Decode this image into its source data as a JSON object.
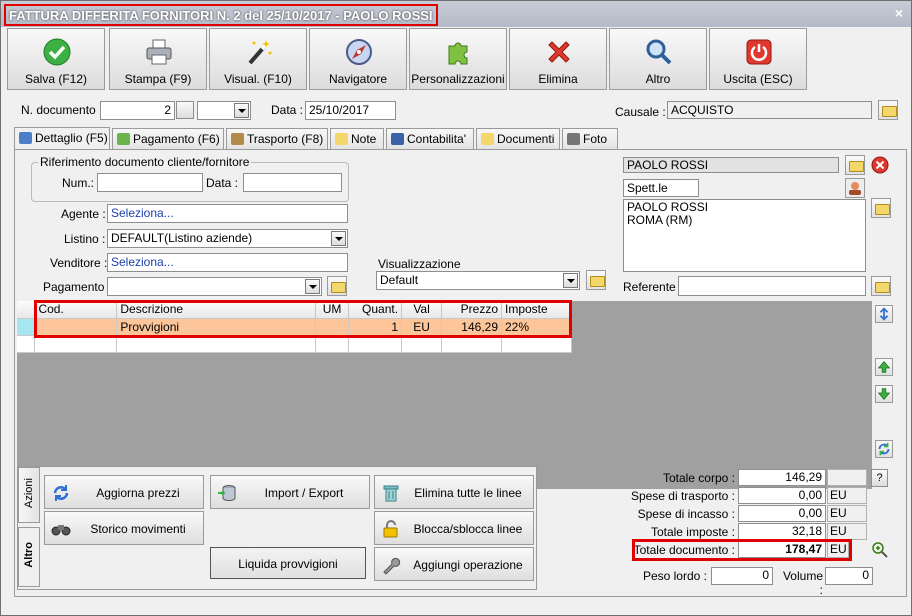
{
  "window": {
    "title": "FATTURA DIFFERITA FORNITORI N. 2 del 25/10/2017 - PAOLO ROSSI",
    "close": "×"
  },
  "toolbar": [
    {
      "label": "Salva (F12)",
      "icon": "check-icon"
    },
    {
      "label": "Stampa (F9)",
      "icon": "printer-icon"
    },
    {
      "label": "Visual. (F10)",
      "icon": "magic-wand-icon"
    },
    {
      "label": "Navigatore",
      "icon": "compass-icon"
    },
    {
      "label": "Personalizzazioni",
      "icon": "puzzle-icon"
    },
    {
      "label": "Elimina",
      "icon": "delete-x-icon"
    },
    {
      "label": "Altro",
      "icon": "magnifier-icon"
    },
    {
      "label": "Uscita (ESC)",
      "icon": "power-icon"
    }
  ],
  "header": {
    "ndoc_label": "N. documento :",
    "ndoc_value": "2",
    "data_label": "Data :",
    "data_value": "25/10/2017",
    "causale_label": "Causale :",
    "causale_value": "ACQUISTO"
  },
  "tabs": [
    "Dettaglio (F5)",
    "Pagamento (F6)",
    "Trasporto (F8)",
    "Note",
    "Contabilita'",
    "Documenti",
    "Foto"
  ],
  "riferimento": {
    "legend": "Riferimento documento cliente/fornitore",
    "num_label": "Num.:",
    "num_value": "",
    "data_label": "Data :",
    "data_value": ""
  },
  "fields": {
    "agente_label": "Agente :",
    "agente_value": "Seleziona...",
    "listino_label": "Listino :",
    "listino_value": "DEFAULT(Listino aziende)",
    "venditore_label": "Venditore :",
    "venditore_value": "Seleziona...",
    "pagamento_label": "Pagamento :",
    "pagamento_value": ""
  },
  "visualizzazione": {
    "legend": "Visualizzazione",
    "value": "Default"
  },
  "cliente": {
    "name": "PAOLO ROSSI",
    "title": "Spett.le",
    "address_line1": "PAOLO ROSSI",
    "address_line2": "ROMA (RM)",
    "referente_label": "Referente",
    "referente_value": ""
  },
  "grid": {
    "columns": [
      "Cod.",
      "Descrizione",
      "UM",
      "Quant.",
      "Val",
      "Prezzo",
      "Imposte"
    ],
    "rows": [
      {
        "cod": "",
        "descrizione": "Provvigioni",
        "um": "",
        "quant": "1",
        "val": "EU",
        "prezzo": "146,29",
        "imposte": "22%"
      }
    ]
  },
  "actions": {
    "vtab_azioni": "Azioni",
    "vtab_altro": "Altro",
    "buttons": [
      {
        "label": "Aggiorna prezzi",
        "icon": "refresh-icon"
      },
      {
        "label": "Import / Export",
        "icon": "database-icon"
      },
      {
        "label": "Elimina tutte le linee",
        "icon": "trash-icon"
      },
      {
        "label": "Storico movimenti",
        "icon": "binoculars-icon"
      },
      {
        "label": "Blocca/sblocca linee",
        "icon": "lock-icon"
      },
      {
        "label": "Liquida provvigioni",
        "icon": ""
      },
      {
        "label": "Aggiungi operazione",
        "icon": "wrench-icon"
      }
    ]
  },
  "totals": {
    "corpo_label": "Totale corpo :",
    "corpo_value": "146,29",
    "help": "?",
    "trasporto_label": "Spese di trasporto :",
    "trasporto_value": "0,00",
    "incasso_label": "Spese di incasso :",
    "incasso_value": "0,00",
    "imposte_label": "Totale imposte :",
    "imposte_value": "32,18",
    "documento_label": "Totale documento :",
    "documento_value": "178,47",
    "currency": "EU",
    "peso_label": "Peso lordo :",
    "peso_value": "0",
    "volume_label": "Volume :",
    "volume_value": "0"
  },
  "colors": {
    "highlight_red": "#e00000",
    "selected_row": "#fcc69a",
    "grid_bg": "#a0a0a0"
  }
}
